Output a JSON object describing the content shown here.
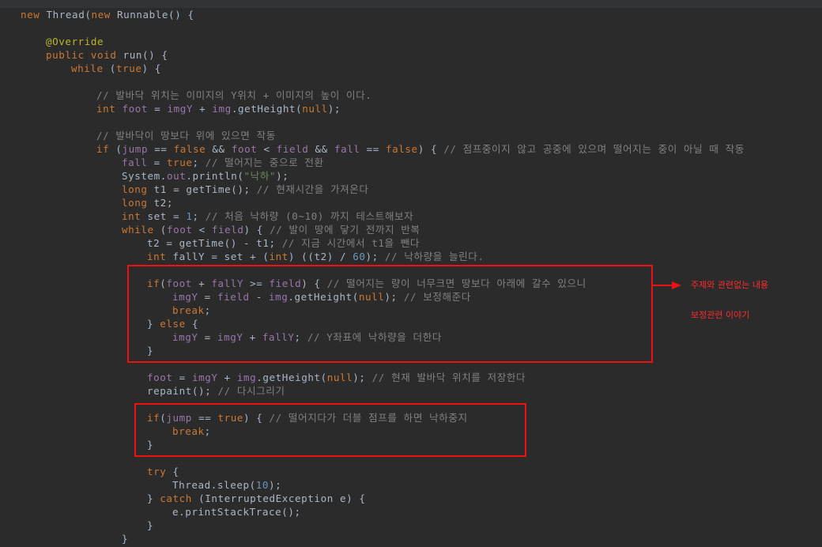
{
  "editor": {
    "lines": [
      {
        "indent": 0,
        "tokens": [
          {
            "t": "new ",
            "c": "kw"
          },
          {
            "t": "Thread(",
            "c": "txt"
          },
          {
            "t": "new ",
            "c": "kw"
          },
          {
            "t": "Runnable() {",
            "c": "txt"
          }
        ]
      },
      {
        "indent": 0,
        "tokens": []
      },
      {
        "indent": 1,
        "tokens": [
          {
            "t": "@Override",
            "c": "ann"
          }
        ]
      },
      {
        "indent": 1,
        "tokens": [
          {
            "t": "public void ",
            "c": "kw"
          },
          {
            "t": "run() {",
            "c": "txt"
          }
        ]
      },
      {
        "indent": 2,
        "tokens": [
          {
            "t": "while ",
            "c": "kw"
          },
          {
            "t": "(",
            "c": "txt"
          },
          {
            "t": "true",
            "c": "kw"
          },
          {
            "t": ") {",
            "c": "txt"
          }
        ]
      },
      {
        "indent": 0,
        "tokens": []
      },
      {
        "indent": 3,
        "tokens": [
          {
            "t": "// 발바닥 위치는 이미지의 Y위치 + 이미지의 높이 이다.",
            "c": "com"
          }
        ]
      },
      {
        "indent": 3,
        "tokens": [
          {
            "t": "int ",
            "c": "kw"
          },
          {
            "t": "foot",
            "c": "fld"
          },
          {
            "t": " = ",
            "c": "txt"
          },
          {
            "t": "imgY",
            "c": "fld"
          },
          {
            "t": " + ",
            "c": "txt"
          },
          {
            "t": "img",
            "c": "fld"
          },
          {
            "t": ".getHeight(",
            "c": "txt"
          },
          {
            "t": "null",
            "c": "kw"
          },
          {
            "t": ");",
            "c": "txt"
          }
        ]
      },
      {
        "indent": 0,
        "tokens": []
      },
      {
        "indent": 3,
        "tokens": [
          {
            "t": "// 발바닥이 땅보다 위에 있으면 작동",
            "c": "com"
          }
        ]
      },
      {
        "indent": 3,
        "tokens": [
          {
            "t": "if ",
            "c": "kw"
          },
          {
            "t": "(",
            "c": "txt"
          },
          {
            "t": "jump",
            "c": "fld"
          },
          {
            "t": " == ",
            "c": "txt"
          },
          {
            "t": "false",
            "c": "kw"
          },
          {
            "t": " && ",
            "c": "txt"
          },
          {
            "t": "foot",
            "c": "fld"
          },
          {
            "t": " < ",
            "c": "txt"
          },
          {
            "t": "field",
            "c": "fld"
          },
          {
            "t": " && ",
            "c": "txt"
          },
          {
            "t": "fall",
            "c": "fld"
          },
          {
            "t": " == ",
            "c": "txt"
          },
          {
            "t": "false",
            "c": "kw"
          },
          {
            "t": ") { ",
            "c": "txt"
          },
          {
            "t": "// 점프중이지 않고 공중에 있으며 떨어지는 중이 아닐 때 작동",
            "c": "com"
          }
        ]
      },
      {
        "indent": 4,
        "tokens": [
          {
            "t": "fall",
            "c": "fld"
          },
          {
            "t": " = ",
            "c": "txt"
          },
          {
            "t": "true",
            "c": "kw"
          },
          {
            "t": "; ",
            "c": "txt"
          },
          {
            "t": "// 떨어지는 중으로 전환",
            "c": "com"
          }
        ]
      },
      {
        "indent": 4,
        "tokens": [
          {
            "t": "System.",
            "c": "txt"
          },
          {
            "t": "out",
            "c": "fld"
          },
          {
            "t": ".println(",
            "c": "txt"
          },
          {
            "t": "\"낙하\"",
            "c": "str"
          },
          {
            "t": ");",
            "c": "txt"
          }
        ]
      },
      {
        "indent": 4,
        "tokens": [
          {
            "t": "long ",
            "c": "kw"
          },
          {
            "t": "t1 = getTime(); ",
            "c": "txt"
          },
          {
            "t": "// 현재시간을 가져온다",
            "c": "com"
          }
        ]
      },
      {
        "indent": 4,
        "tokens": [
          {
            "t": "long ",
            "c": "kw"
          },
          {
            "t": "t2;",
            "c": "txt"
          }
        ]
      },
      {
        "indent": 4,
        "tokens": [
          {
            "t": "int ",
            "c": "kw"
          },
          {
            "t": "set = ",
            "c": "txt"
          },
          {
            "t": "1",
            "c": "num"
          },
          {
            "t": "; ",
            "c": "txt"
          },
          {
            "t": "// 처음 낙하량 (0~10) 까지 테스트해보자",
            "c": "com"
          }
        ]
      },
      {
        "indent": 4,
        "tokens": [
          {
            "t": "while ",
            "c": "kw"
          },
          {
            "t": "(",
            "c": "txt"
          },
          {
            "t": "foot",
            "c": "fld"
          },
          {
            "t": " < ",
            "c": "txt"
          },
          {
            "t": "field",
            "c": "fld"
          },
          {
            "t": ") { ",
            "c": "txt"
          },
          {
            "t": "// 발이 땅에 닿기 전까지 반복",
            "c": "com"
          }
        ]
      },
      {
        "indent": 5,
        "tokens": [
          {
            "t": "t2 = getTime() - t1; ",
            "c": "txt"
          },
          {
            "t": "// 지금 시간에서 t1을 뺀다",
            "c": "com"
          }
        ]
      },
      {
        "indent": 5,
        "tokens": [
          {
            "t": "int ",
            "c": "kw"
          },
          {
            "t": "fallY = set + (",
            "c": "txt"
          },
          {
            "t": "int",
            "c": "kw"
          },
          {
            "t": ") ((t2) / ",
            "c": "txt"
          },
          {
            "t": "60",
            "c": "num"
          },
          {
            "t": "); ",
            "c": "txt"
          },
          {
            "t": "// 낙하량을 늘린다.",
            "c": "com"
          }
        ]
      },
      {
        "indent": 0,
        "tokens": []
      },
      {
        "indent": 5,
        "tokens": [
          {
            "t": "if",
            "c": "kw"
          },
          {
            "t": "(",
            "c": "txt"
          },
          {
            "t": "foot",
            "c": "fld"
          },
          {
            "t": " + ",
            "c": "txt"
          },
          {
            "t": "fallY",
            "c": "fld"
          },
          {
            "t": " >= ",
            "c": "txt"
          },
          {
            "t": "field",
            "c": "fld"
          },
          {
            "t": ") { ",
            "c": "txt"
          },
          {
            "t": "// 떨어지는 량이 너무크면 땅보다 아래에 갈수 있으니",
            "c": "com"
          }
        ]
      },
      {
        "indent": 6,
        "tokens": [
          {
            "t": "imgY",
            "c": "fld"
          },
          {
            "t": " = ",
            "c": "txt"
          },
          {
            "t": "field",
            "c": "fld"
          },
          {
            "t": " - ",
            "c": "txt"
          },
          {
            "t": "img",
            "c": "fld"
          },
          {
            "t": ".getHeight(",
            "c": "txt"
          },
          {
            "t": "null",
            "c": "kw"
          },
          {
            "t": "); ",
            "c": "txt"
          },
          {
            "t": "// 보정해준다",
            "c": "com"
          }
        ]
      },
      {
        "indent": 6,
        "tokens": [
          {
            "t": "break",
            "c": "kw"
          },
          {
            "t": ";",
            "c": "txt"
          }
        ]
      },
      {
        "indent": 5,
        "tokens": [
          {
            "t": "} ",
            "c": "txt"
          },
          {
            "t": "else ",
            "c": "kw"
          },
          {
            "t": "{",
            "c": "txt"
          }
        ]
      },
      {
        "indent": 6,
        "tokens": [
          {
            "t": "imgY",
            "c": "fld"
          },
          {
            "t": " = ",
            "c": "txt"
          },
          {
            "t": "imgY",
            "c": "fld"
          },
          {
            "t": " + ",
            "c": "txt"
          },
          {
            "t": "fallY",
            "c": "fld"
          },
          {
            "t": "; ",
            "c": "txt"
          },
          {
            "t": "// Y좌표에 낙하량을 더한다",
            "c": "com"
          }
        ]
      },
      {
        "indent": 5,
        "tokens": [
          {
            "t": "}",
            "c": "txt"
          }
        ]
      },
      {
        "indent": 0,
        "tokens": []
      },
      {
        "indent": 5,
        "tokens": [
          {
            "t": "foot",
            "c": "fld"
          },
          {
            "t": " = ",
            "c": "txt"
          },
          {
            "t": "imgY",
            "c": "fld"
          },
          {
            "t": " + ",
            "c": "txt"
          },
          {
            "t": "img",
            "c": "fld"
          },
          {
            "t": ".getHeight(",
            "c": "txt"
          },
          {
            "t": "null",
            "c": "kw"
          },
          {
            "t": "); ",
            "c": "txt"
          },
          {
            "t": "// 현재 발바닥 위치를 저장한다",
            "c": "com"
          }
        ]
      },
      {
        "indent": 5,
        "tokens": [
          {
            "t": "repaint(); ",
            "c": "txt"
          },
          {
            "t": "// 다시그리기",
            "c": "com"
          }
        ]
      },
      {
        "indent": 0,
        "tokens": []
      },
      {
        "indent": 5,
        "tokens": [
          {
            "t": "if",
            "c": "kw"
          },
          {
            "t": "(",
            "c": "txt"
          },
          {
            "t": "jump",
            "c": "fld"
          },
          {
            "t": " == ",
            "c": "txt"
          },
          {
            "t": "true",
            "c": "kw"
          },
          {
            "t": ") { ",
            "c": "txt"
          },
          {
            "t": "// 떨어지다가 더블 점프를 하면 낙하중지",
            "c": "com"
          }
        ]
      },
      {
        "indent": 6,
        "tokens": [
          {
            "t": "break",
            "c": "kw"
          },
          {
            "t": ";",
            "c": "txt"
          }
        ]
      },
      {
        "indent": 5,
        "tokens": [
          {
            "t": "}",
            "c": "txt"
          }
        ]
      },
      {
        "indent": 0,
        "tokens": []
      },
      {
        "indent": 5,
        "tokens": [
          {
            "t": "try ",
            "c": "kw"
          },
          {
            "t": "{",
            "c": "txt"
          }
        ]
      },
      {
        "indent": 6,
        "tokens": [
          {
            "t": "Thread.",
            "c": "txt"
          },
          {
            "t": "sleep",
            "c": "txt"
          },
          {
            "t": "(",
            "c": "txt"
          },
          {
            "t": "10",
            "c": "num"
          },
          {
            "t": ");",
            "c": "txt"
          }
        ]
      },
      {
        "indent": 5,
        "tokens": [
          {
            "t": "} ",
            "c": "txt"
          },
          {
            "t": "catch ",
            "c": "kw"
          },
          {
            "t": "(InterruptedException e) {",
            "c": "txt"
          }
        ]
      },
      {
        "indent": 6,
        "tokens": [
          {
            "t": "e.printStackTrace();",
            "c": "txt"
          }
        ]
      },
      {
        "indent": 5,
        "tokens": [
          {
            "t": "}",
            "c": "txt"
          }
        ]
      },
      {
        "indent": 4,
        "tokens": [
          {
            "t": "}",
            "c": "txt"
          }
        ]
      }
    ]
  },
  "annotations": {
    "note_1": "주제와 관련없는 내용",
    "note_2": "보정관련 이야기"
  },
  "colors": {
    "background": "#2b2b2b",
    "keyword": "#cc7832",
    "annotation": "#bbb529",
    "field": "#9876aa",
    "number": "#6897bb",
    "string": "#6a8759",
    "comment": "#808080",
    "text": "#a9b7c6",
    "highlight_box": "#ee1111"
  }
}
